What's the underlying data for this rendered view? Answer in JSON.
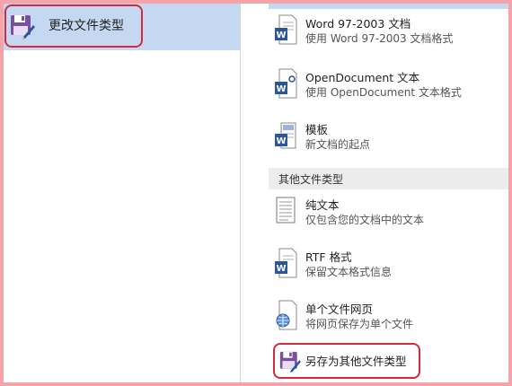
{
  "left_panel": {
    "selected_item": {
      "label": "更改文件类型",
      "icon": "save-as-purple-icon"
    }
  },
  "document_types": [
    {
      "title": "Word 97-2003 文档",
      "description": "使用 Word 97-2003 文档格式",
      "icon": "word-doc-icon"
    },
    {
      "title": "OpenDocument 文本",
      "description": "使用 OpenDocument 文本格式",
      "icon": "opendocument-icon"
    },
    {
      "title": "模板",
      "description": "新文档的起点",
      "icon": "template-icon"
    }
  ],
  "other_section": {
    "header": "其他文件类型"
  },
  "other_types": [
    {
      "title": "纯文本",
      "description": "仅包含您的文档中的文本",
      "icon": "plain-text-icon"
    },
    {
      "title": "RTF 格式",
      "description": "保留文本格式信息",
      "icon": "rtf-icon"
    },
    {
      "title": "单个文件网页",
      "description": "将网页保存为单个文件",
      "icon": "single-file-webpage-icon"
    }
  ],
  "save_other": {
    "label": "另存为其他文件类型",
    "icon": "save-as-purple-icon"
  },
  "colors": {
    "border": "#f4a4a9",
    "selected_bg": "#c5d8f2",
    "highlight": "#d32a3f",
    "word_blue": "#2b579a",
    "purple": "#7a4fa0"
  }
}
